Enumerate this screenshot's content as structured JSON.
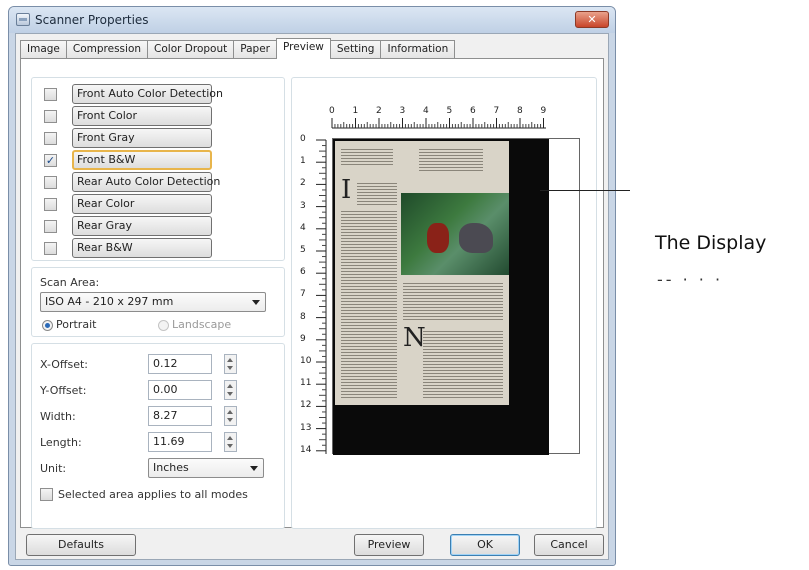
{
  "window": {
    "title": "Scanner Properties",
    "close_glyph": "✕"
  },
  "tabs": [
    "Image",
    "Compression",
    "Color Dropout",
    "Paper",
    "Preview",
    "Setting",
    "Information"
  ],
  "active_tab": "Preview",
  "modes": [
    {
      "label": "Front Auto Color Detection",
      "checked": false
    },
    {
      "label": "Front Color",
      "checked": false
    },
    {
      "label": "Front Gray",
      "checked": false
    },
    {
      "label": "Front B&W",
      "checked": true
    },
    {
      "label": "Rear Auto Color Detection",
      "checked": false
    },
    {
      "label": "Rear Color",
      "checked": false
    },
    {
      "label": "Rear Gray",
      "checked": false
    },
    {
      "label": "Rear B&W",
      "checked": false
    }
  ],
  "scan_area": {
    "label": "Scan Area:",
    "value": "ISO A4 - 210 x 297 mm",
    "portrait_label": "Portrait",
    "landscape_label": "Landscape",
    "orientation": "Portrait"
  },
  "offsets": {
    "x_label": "X-Offset:",
    "x_value": "0.12",
    "y_label": "Y-Offset:",
    "y_value": "0.00",
    "width_label": "Width:",
    "width_value": "8.27",
    "length_label": "Length:",
    "length_value": "11.69",
    "unit_label": "Unit:",
    "unit_value": "Inches"
  },
  "apply_all": {
    "label": "Selected area applies to all modes",
    "checked": false
  },
  "ruler": {
    "top": [
      "0",
      "1",
      "2",
      "3",
      "4",
      "5",
      "6",
      "7",
      "8",
      "9"
    ],
    "left": [
      "0",
      "1",
      "2",
      "3",
      "4",
      "5",
      "6",
      "7",
      "8",
      "9",
      "10",
      "11",
      "12",
      "13",
      "14"
    ]
  },
  "buttons": {
    "defaults": "Defaults",
    "preview": "Preview",
    "ok": "OK",
    "cancel": "Cancel"
  },
  "callout": {
    "text": "The Display",
    "sub": "-- · · ·"
  }
}
